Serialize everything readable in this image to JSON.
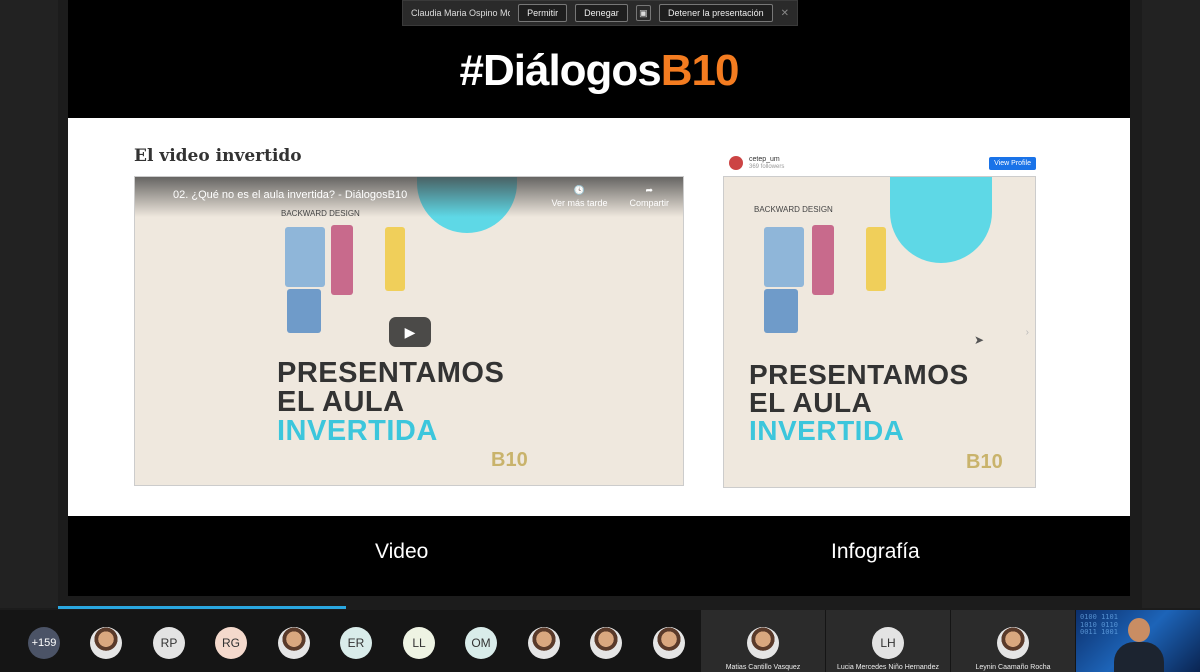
{
  "share_toolbar": {
    "presenter": "Claudia Maria Ospino Mo...",
    "allow_label": "Permitir",
    "deny_label": "Denegar",
    "stop_label": "Detener la presentación"
  },
  "slide": {
    "brand_white": "#Diálogos",
    "brand_orange": "B10",
    "heading": "El video invertido",
    "video": {
      "title": "02. ¿Qué no es el aula invertida? - DiálogosB10",
      "watch_later": "Ver más tarde",
      "share": "Compartir",
      "kicker": "BACKWARD DESIGN",
      "line1": "PRESENTAMOS",
      "line2": "EL AULA",
      "line3": "INVERTIDA",
      "logo": "B10"
    },
    "infographic": {
      "account": "cetep_um",
      "followers": "369 followers",
      "view_profile": "View Profile",
      "kicker": "BACKWARD DESIGN",
      "line1": "PRESENTAMOS",
      "line2": "EL AULA",
      "line3": "INVERTIDA",
      "logo": "B10"
    },
    "caption_video": "Video",
    "caption_infographic": "Infografía"
  },
  "participants": {
    "more_count": "+159",
    "initials": [
      "RP",
      "RG",
      "ER",
      "LL",
      "OM",
      "LH"
    ],
    "tiles": [
      "Matias Cantillo Vasquez",
      "Lucia Mercedes Niño Hernandez",
      "Leynin Caamaño Rocha"
    ]
  },
  "colors": {
    "accent_orange": "#f47c20",
    "cyan": "#3cc6dc",
    "progress": "#2aa7e0"
  }
}
